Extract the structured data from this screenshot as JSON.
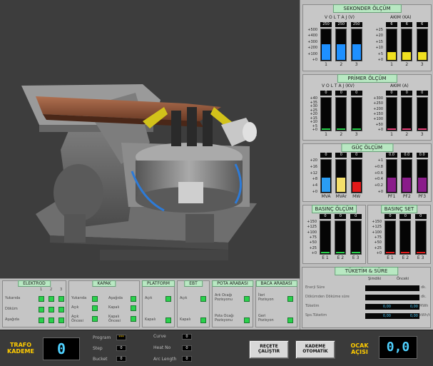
{
  "sekonder": {
    "title": "SEKONDER ÖLÇÜM",
    "voltaj_label": "V O L T A J (V)",
    "akim_label": "AKIM (KA)",
    "volt_scale": [
      "+500",
      "+400",
      "+300",
      "+200",
      "+100",
      "+0"
    ],
    "akim_scale": [
      "+25",
      "+20",
      "+15",
      "+10",
      "+5",
      "+0"
    ],
    "volt_bars": [
      {
        "val": "250",
        "label": "1",
        "level": 0.5
      },
      {
        "val": "250",
        "label": "2",
        "level": 0.5
      },
      {
        "val": "250",
        "label": "3",
        "level": 0.5
      }
    ],
    "akim_bars": [
      {
        "val": "6",
        "label": "1",
        "level": 0.24
      },
      {
        "val": "6",
        "label": "2",
        "level": 0.24
      },
      {
        "val": "6",
        "label": "3",
        "level": 0.24
      }
    ]
  },
  "primer": {
    "title": "PRİMER ÖLÇÜM",
    "voltaj_label": "V O L T A J (KV)",
    "akim_label": "AKIM (A)",
    "volt_scale": [
      "+40",
      "+35",
      "+30",
      "+25",
      "+20",
      "+15",
      "+10",
      "+5",
      "+0"
    ],
    "akim_scale": [
      "+300",
      "+250",
      "+200",
      "+150",
      "+100",
      "+50",
      "+0"
    ],
    "volt_bars": [
      {
        "val": "0",
        "label": "1",
        "level": 0.04
      },
      {
        "val": "0",
        "label": "2",
        "level": 0.04
      },
      {
        "val": "0",
        "label": "3",
        "level": 0.04
      }
    ],
    "akim_bars": [
      {
        "val": "0",
        "label": "1",
        "level": 0.03
      },
      {
        "val": "0",
        "label": "2",
        "level": 0.03
      },
      {
        "val": "0",
        "label": "3",
        "level": 0.03
      }
    ]
  },
  "guc": {
    "title": "GÜÇ ÖLÇÜM",
    "left_scale": [
      "+20",
      "+16",
      "+12",
      "+8",
      "+4",
      "+0"
    ],
    "right_scale": [
      "+1",
      "+0.8",
      "+0.6",
      "+0.4",
      "+0.2",
      "+0"
    ],
    "left_bars": [
      {
        "val": "0",
        "label": "MVA",
        "color": "#2a9df4",
        "level": 0.44
      },
      {
        "val": "0",
        "label": "MVAr",
        "color": "#f5e06a",
        "level": 0.44
      },
      {
        "val": "0",
        "label": "MW",
        "color": "#e21a1a",
        "level": 0.3
      }
    ],
    "right_bars": [
      {
        "val": "0.0",
        "label": "PF1",
        "color": "#8a1c8a",
        "level": 0.44
      },
      {
        "val": "0.0",
        "label": "PF2",
        "color": "#8a1c8a",
        "level": 0.44
      },
      {
        "val": "0.0",
        "label": "PF3",
        "color": "#8a1c8a",
        "level": 0.44
      }
    ]
  },
  "basinc_olcum": {
    "title": "BASINÇ ÖLÇÜM",
    "scale": [
      "+150",
      "+125",
      "+100",
      "+75",
      "+50",
      "+25",
      "+0"
    ],
    "bars": [
      {
        "val": "0",
        "label": "E 1",
        "level": 0.02
      },
      {
        "val": "0",
        "label": "E 2",
        "level": 0.02
      },
      {
        "val": "0",
        "label": "E 3",
        "level": 0.02
      }
    ]
  },
  "basinc_set": {
    "title": "BASINÇ SET",
    "scale": [
      "+150",
      "+125",
      "+100",
      "+75",
      "+50",
      "+25",
      "+0"
    ],
    "bars": [
      {
        "val": "0",
        "label": "E 1",
        "level": 0.02
      },
      {
        "val": "0",
        "label": "E 2",
        "level": 0.02
      },
      {
        "val": "0",
        "label": "E 3",
        "level": 0.02
      }
    ]
  },
  "tuketim": {
    "title": "TÜKETİM & SÜRE",
    "col_simdiki": "Şimdiki",
    "col_onceki": "Önceki",
    "rows": [
      {
        "label": "Enerji Süre",
        "unit": "dk."
      },
      {
        "label": "Dökümden Döküme süre",
        "unit": "dk."
      },
      {
        "label": "Tüketim",
        "v1": "0,00",
        "v2": "0,00",
        "unit": "MWh"
      },
      {
        "label": "Sps.Tüketim",
        "v1": "0,00",
        "v2": "0,00",
        "unit": "kWh/t"
      }
    ]
  },
  "elektrod": {
    "title": "ELEKTROD",
    "cols": [
      "1",
      "2",
      "3"
    ],
    "rows": [
      "Yukarıda",
      "Döküm",
      "Aşağıda"
    ]
  },
  "kapak": {
    "title": "KAPAK",
    "left": [
      "Yukarıda",
      "Açık",
      "Açık Öncesi"
    ],
    "right": [
      "Aşağıda",
      "Kapalı",
      "Kapalı Öncesi"
    ]
  },
  "platform": {
    "title": "PLATFORM",
    "items": [
      "Açık",
      "Kapalı"
    ]
  },
  "ebt": {
    "title": "EBT",
    "items": [
      "Açık",
      "Kapalı"
    ]
  },
  "pota": {
    "title": "POTA ARABASI",
    "items": [
      "Ark Ocağı Pozisyonu",
      "Pota Ocağı Pozisyonu"
    ]
  },
  "baca": {
    "title": "BACA ARABASI",
    "items": [
      "İleri Pozisyon",
      "Geri Pozisyon"
    ]
  },
  "footer": {
    "trafo_label": "TRAFO KADEME",
    "trafo_value": "0",
    "program_label": "Program",
    "program_value": "***",
    "step_label": "Step",
    "step_value": "0",
    "bucket_label": "Bucket",
    "bucket_value": "0",
    "curve_label": "Curve",
    "curve_value": "0",
    "heat_label": "Heat No",
    "heat_value": "0",
    "arc_label": "Arc Length",
    "arc_value": "0",
    "recete_button": "REÇETE ÇALIŞTIR",
    "kademe_button": "KADEME OTOMATİK",
    "ocak_label": "OCAK AÇISI",
    "ocak_value": "0,0"
  },
  "colors": {
    "volt_blue": "#1e90ff",
    "akim_yellow": "#f0e020",
    "led_green": "#29d14b",
    "title_green": "#b8e8c2",
    "accent_yellow": "#ffcc00",
    "digit_cyan": "#4fd1ff"
  }
}
